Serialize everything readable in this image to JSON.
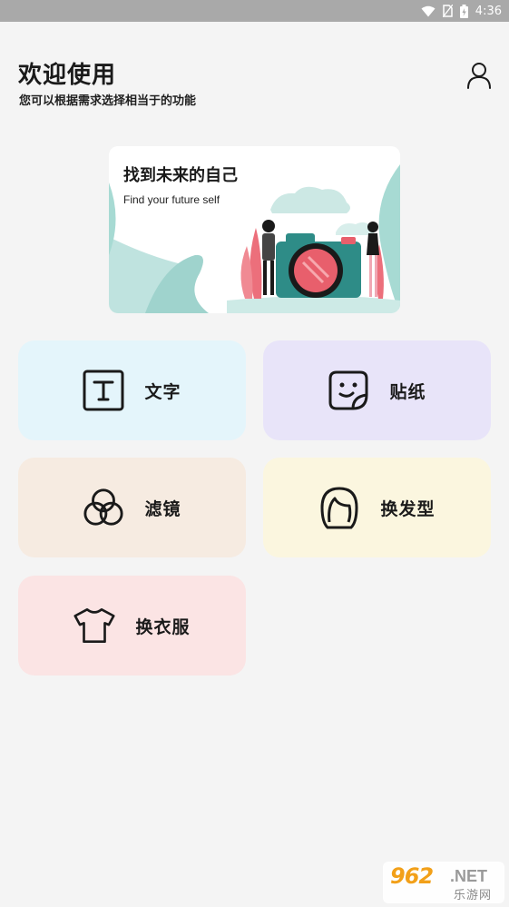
{
  "status_bar": {
    "time": "4:36"
  },
  "header": {
    "title": "欢迎使用",
    "subtitle": "您可以根据需求选择相当于的功能"
  },
  "banner": {
    "title": "找到未来的自己",
    "subtitle": "Find your future self"
  },
  "features": [
    {
      "label": "文字",
      "icon": "text-icon",
      "color": "#e4f5fb"
    },
    {
      "label": "贴纸",
      "icon": "sticker-icon",
      "color": "#e8e4f9"
    },
    {
      "label": "滤镜",
      "icon": "filter-icon",
      "color": "#f6ebe1"
    },
    {
      "label": "换发型",
      "icon": "hair-icon",
      "color": "#fbf6df"
    },
    {
      "label": "换衣服",
      "icon": "tshirt-icon",
      "color": "#fbe4e4"
    }
  ],
  "watermark": {
    "main": "962",
    "net": ".NET",
    "sub": "乐游网"
  }
}
